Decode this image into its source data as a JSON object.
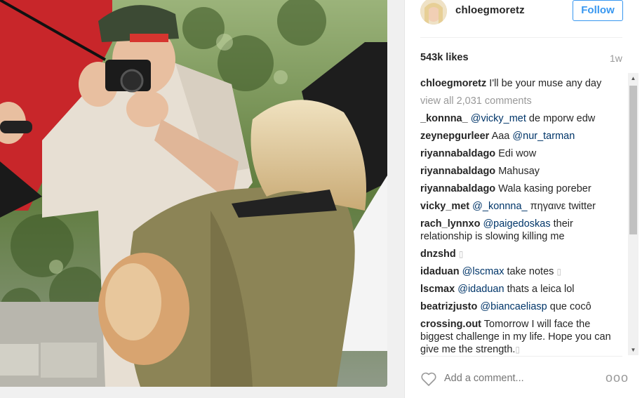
{
  "post": {
    "username": "chloegmoretz",
    "follow_label": "Follow",
    "likes": "543k likes",
    "timestamp": "1w",
    "caption": {
      "user": "chloegmoretz",
      "text": "I'll be your muse any day"
    },
    "view_all": "view all 2,031 comments",
    "comments": [
      {
        "user": "_konnna_",
        "parts": [
          {
            "t": "mention",
            "v": "@vicky_met"
          },
          {
            "t": "text",
            "v": " de mporw edw"
          }
        ]
      },
      {
        "user": "zeynepgurleer",
        "parts": [
          {
            "t": "text",
            "v": "Aaa "
          },
          {
            "t": "mention",
            "v": "@nur_tarman"
          }
        ]
      },
      {
        "user": "riyannabaldago",
        "parts": [
          {
            "t": "text",
            "v": "Edi wow"
          }
        ]
      },
      {
        "user": "riyannabaldago",
        "parts": [
          {
            "t": "text",
            "v": "Mahusay"
          }
        ]
      },
      {
        "user": "riyannabaldago",
        "parts": [
          {
            "t": "text",
            "v": "Wala kasing poreber"
          }
        ]
      },
      {
        "user": "vicky_met",
        "parts": [
          {
            "t": "mention",
            "v": "@_konnna_"
          },
          {
            "t": "text",
            "v": " πηγαινε twitter"
          }
        ]
      },
      {
        "user": "rach_lynnxo",
        "parts": [
          {
            "t": "mention",
            "v": "@paigedoskas"
          },
          {
            "t": "text",
            "v": " their relationship is slowing killing me"
          }
        ]
      },
      {
        "user": "dnzshd",
        "parts": [
          {
            "t": "glyph",
            "v": "▯"
          }
        ]
      },
      {
        "user": "idaduan",
        "parts": [
          {
            "t": "mention",
            "v": "@lscmax"
          },
          {
            "t": "text",
            "v": " take notes "
          },
          {
            "t": "glyph",
            "v": "▯"
          }
        ]
      },
      {
        "user": "lscmax",
        "parts": [
          {
            "t": "mention",
            "v": "@idaduan"
          },
          {
            "t": "text",
            "v": " thats a leica lol"
          }
        ]
      },
      {
        "user": "beatrizjusto",
        "parts": [
          {
            "t": "mention",
            "v": "@biancaeliasp"
          },
          {
            "t": "text",
            "v": " que cocô"
          }
        ]
      },
      {
        "user": "crossing.out",
        "parts": [
          {
            "t": "text",
            "v": "Tomorrow I will face the biggest challenge in my life. Hope you can give me the strength."
          },
          {
            "t": "glyph",
            "v": "▯"
          }
        ]
      }
    ],
    "add_comment_placeholder": "Add a comment...",
    "more_label": "ooo"
  },
  "colors": {
    "accent": "#3897f0",
    "mention": "#003569",
    "muted": "#999999"
  },
  "icons": {
    "like": "heart-icon",
    "more": "more-options-icon",
    "scroll_up": "scroll-up-arrow-icon",
    "scroll_down": "scroll-down-arrow-icon"
  }
}
